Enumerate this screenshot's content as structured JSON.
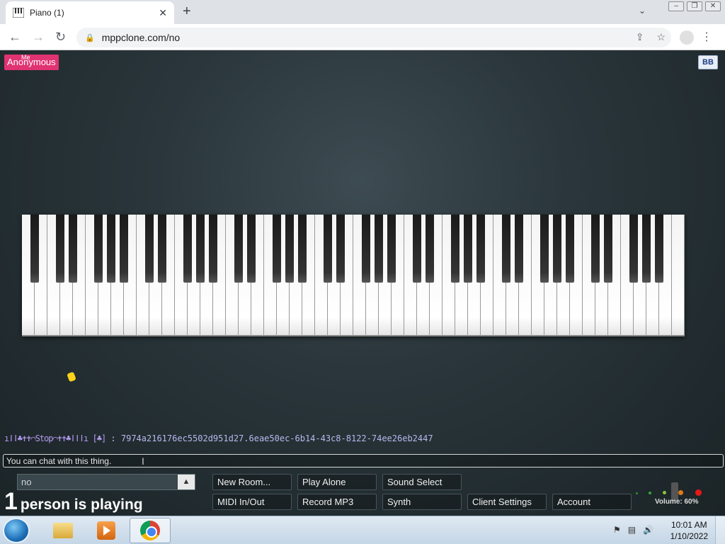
{
  "browser": {
    "tab_title": "Piano (1)",
    "tab_close": "✕",
    "new_tab": "+",
    "tab_dropdown": "⌄",
    "url": "mppclone.com/no",
    "lock_icon": "🔒",
    "back": "←",
    "forward": "→",
    "reload": "↻",
    "share": "⇪",
    "star": "☆",
    "menu": "⋮",
    "win_min": "–",
    "win_restore": "❐",
    "win_close": "✕"
  },
  "page": {
    "user_badge": "Anonymous",
    "user_badge_me": "Me",
    "bb_button": "BB",
    "chat_nick": "ıǀǀ♣✝✝⌒Stop⌒✝✝♣ǀǀǀı [♣]",
    "chat_separator": ":",
    "chat_message": "7974a216176ec5502d951d27.6eae50ec-6b14-43c8-8122-74ee26eb2447",
    "chat_placeholder": "You can chat with this thing.",
    "room_name": "no",
    "room_arrow": "▲",
    "player_count_num": "1",
    "player_count_text": "person is playing",
    "buttons": {
      "new_room": "New Room...",
      "play_alone": "Play Alone",
      "sound_select": "Sound Select",
      "midi": "MIDI In/Out",
      "record": "Record MP3",
      "synth": "Synth",
      "client_settings": "Client Settings",
      "account": "Account"
    },
    "volume_label": "Volume: 60%",
    "volume_value": 0.6,
    "piano": {
      "white_keys": 52,
      "octaves_pattern": "A0-C8"
    }
  },
  "taskbar": {
    "time": "10:01 AM",
    "date": "1/10/2022",
    "tray_icons": [
      "flag-icon",
      "network-icon",
      "speaker-icon"
    ],
    "tray_glyphs": [
      "⚑",
      "▤",
      "🔊"
    ]
  },
  "colors": {
    "badge": "#e03371",
    "accent_chat": "#b7b9ee"
  }
}
